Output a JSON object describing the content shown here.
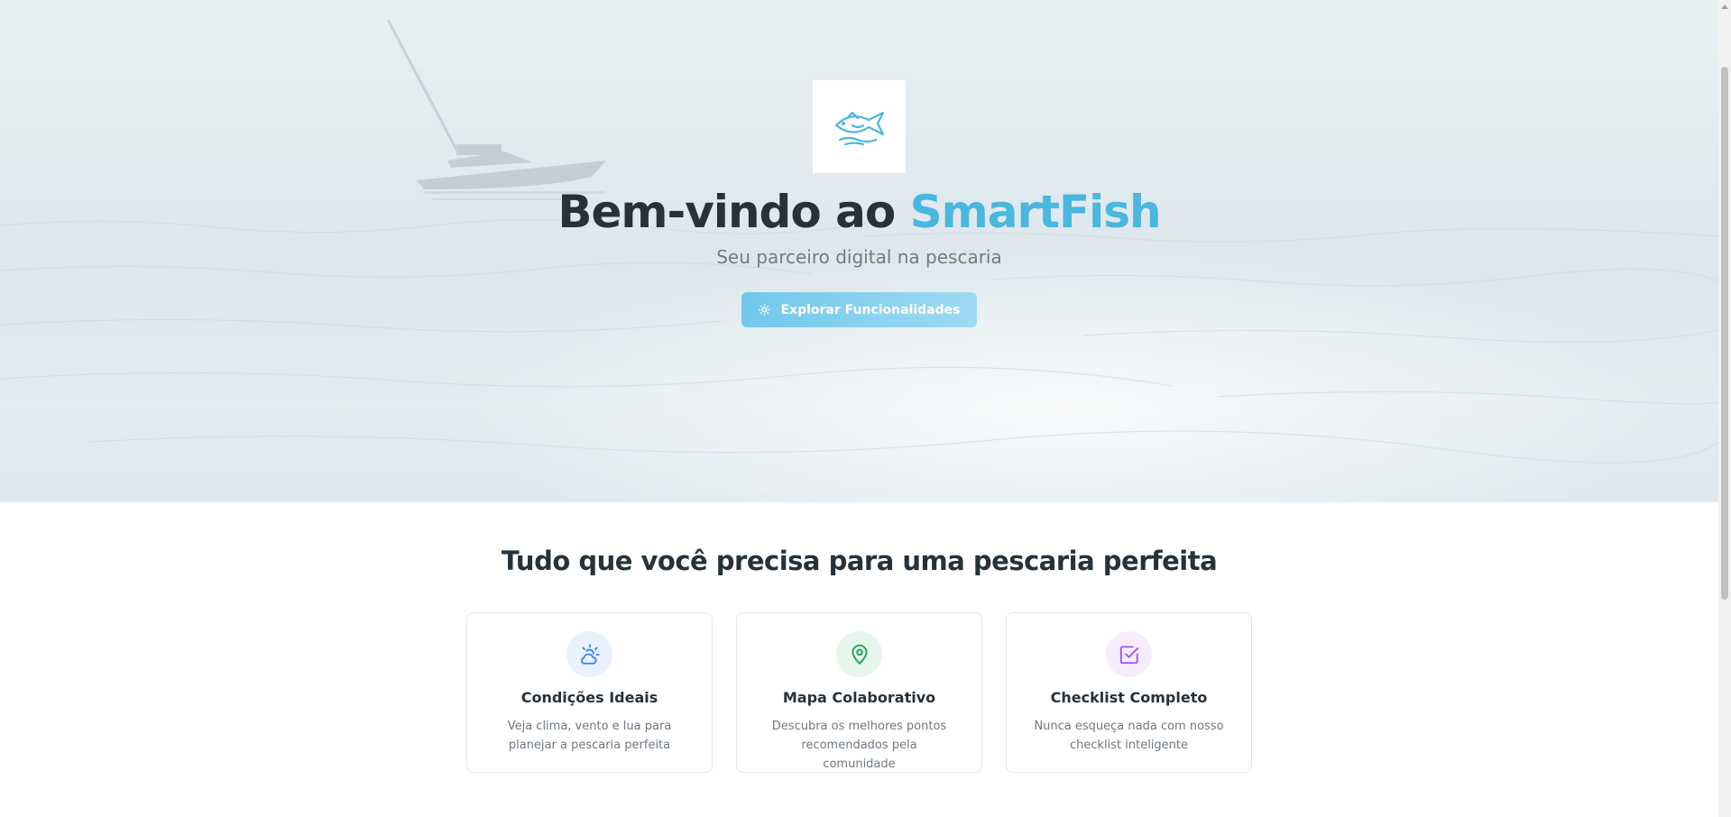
{
  "hero": {
    "title_prefix": "Bem-vindo ao ",
    "title_brand": "SmartFish",
    "subtitle": "Seu parceiro digital na pescaria",
    "cta_label": "Explorar Funcionalidades",
    "cta_icon": "gear-icon",
    "logo_icon": "fish-logo-icon"
  },
  "features": {
    "title": "Tudo que você precisa para uma pescaria perfeita",
    "cards": [
      {
        "icon": "sun-cloud-icon",
        "title": "Condições Ideais",
        "desc": "Veja clima, vento e lua para planejar a pescaria perfeita",
        "icon_color": "#3b82f6",
        "icon_bg": "#e9f1fd"
      },
      {
        "icon": "map-pin-icon",
        "title": "Mapa Colaborativo",
        "desc": "Descubra os melhores pontos recomendados pela comunidade",
        "icon_color": "#22a55a",
        "icon_bg": "#e7f6ec"
      },
      {
        "icon": "checkbox-icon",
        "title": "Checklist Completo",
        "desc": "Nunca esqueça nada com nosso checklist inteligente",
        "icon_color": "#a855f7",
        "icon_bg": "#f5edfd"
      }
    ]
  },
  "colors": {
    "brand": "#49b7de",
    "heading": "#26323a",
    "muted": "#707b82"
  }
}
